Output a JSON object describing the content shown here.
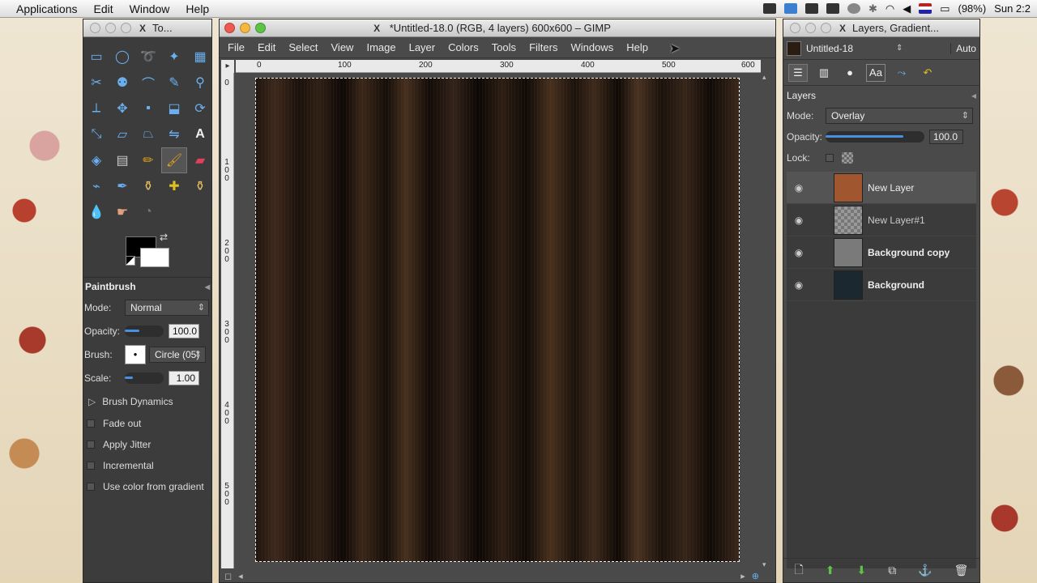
{
  "menubar": {
    "apple_menu_label": "Applications",
    "items": [
      "Edit",
      "Window",
      "Help"
    ],
    "battery": "(98%)",
    "clock": "Sun 2:2"
  },
  "toolbox": {
    "title": "To...",
    "tools": [
      "rect-select",
      "ellipse-select",
      "free-select",
      "fuzzy-select",
      "select-by-color",
      "scissors",
      "foreground-select",
      "paths",
      "color-picker",
      "zoom",
      "measure",
      "move",
      "align",
      "crop",
      "rotate",
      "scale",
      "shear",
      "perspective",
      "flip",
      "text",
      "bucket-fill",
      "blend",
      "pencil",
      "paintbrush",
      "eraser",
      "airbrush",
      "ink",
      "clone",
      "heal",
      "perspective-clone",
      "blur",
      "smudge",
      "dodge-burn"
    ],
    "active_tool": "paintbrush",
    "options": {
      "title": "Paintbrush",
      "mode_label": "Mode:",
      "mode_value": "Normal",
      "opacity_label": "Opacity:",
      "opacity_value": "100.0",
      "opacity_fraction": 1.0,
      "brush_label": "Brush:",
      "brush_value": "Circle (05)",
      "scale_label": "Scale:",
      "scale_value": "1.00",
      "brush_dynamics": "Brush Dynamics",
      "checks": [
        "Fade out",
        "Apply Jitter",
        "Incremental",
        "Use color from gradient"
      ]
    }
  },
  "image_window": {
    "title": "*Untitled-18.0 (RGB, 4 layers) 600x600 – GIMP",
    "menu": [
      "File",
      "Edit",
      "Select",
      "View",
      "Image",
      "Layer",
      "Colors",
      "Tools",
      "Filters",
      "Windows",
      "Help"
    ],
    "h_ruler": [
      "0",
      "100",
      "200",
      "300",
      "400",
      "500",
      "600"
    ],
    "v_ruler": [
      "0",
      "1\n0\n0",
      "2\n0\n0",
      "3\n0\n0",
      "4\n0\n0",
      "5\n0\n0"
    ]
  },
  "layers_window": {
    "title": "Layers, Gradient...",
    "image_name": "Untitled-18",
    "auto_label": "Auto",
    "panel_title": "Layers",
    "mode_label": "Mode:",
    "mode_value": "Overlay",
    "opacity_label": "Opacity:",
    "opacity_value": "100.0",
    "opacity_fraction": 1.0,
    "lock_label": "Lock:",
    "layers": [
      {
        "name": "New Layer",
        "color": "#a0562e",
        "selected": true
      },
      {
        "name": "New Layer#1",
        "color": "#8a8a8a",
        "selected": false
      },
      {
        "name": "Background copy",
        "color": "#777777",
        "selected": false
      },
      {
        "name": "Background",
        "color": "#1b2830",
        "selected": false
      }
    ]
  },
  "colors": {
    "accent": "#4a90e2",
    "panel_bg": "#4a4a4a"
  }
}
